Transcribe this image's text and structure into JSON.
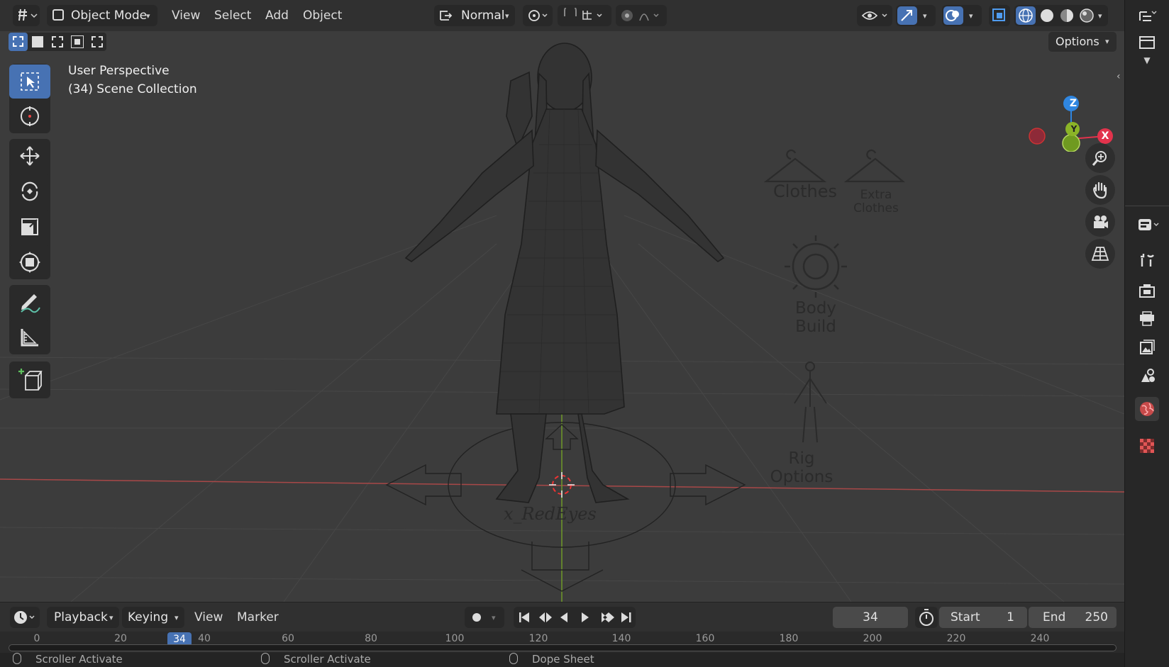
{
  "header": {
    "mode": "Object Mode",
    "menus": [
      "View",
      "Select",
      "Add",
      "Object"
    ],
    "orientation": "Normal",
    "options_label": "Options"
  },
  "viewport": {
    "perspective_label": "User Perspective",
    "collection_label": "(34) Scene Collection",
    "gizmo_axes": {
      "z": "Z",
      "y": "Y",
      "x": "X"
    },
    "scene_labels": {
      "clothes": "Clothes",
      "extra_clothes": "Extra Clothes",
      "body_build": "Body Build",
      "rig_options": "Rig Options",
      "signature": "x_RedEyes"
    }
  },
  "timeline": {
    "menus": [
      "Playback",
      "Keying",
      "View",
      "Marker"
    ],
    "current_frame": "34",
    "start_label": "Start",
    "start_value": "1",
    "end_label": "End",
    "end_value": "250",
    "ruler_ticks": [
      "0",
      "20",
      "34",
      "40",
      "60",
      "80",
      "100",
      "120",
      "140",
      "160",
      "180",
      "200",
      "220",
      "240"
    ]
  },
  "statusbar": {
    "items": [
      "Scroller Activate",
      "Scroller Activate",
      "Dope Sheet"
    ]
  },
  "colors": {
    "accent": "#4772b3",
    "x_axis": "#e2334c",
    "y_axis": "#8bb427",
    "z_axis": "#2f86e0",
    "viewport_bg": "#3c3c3c"
  }
}
